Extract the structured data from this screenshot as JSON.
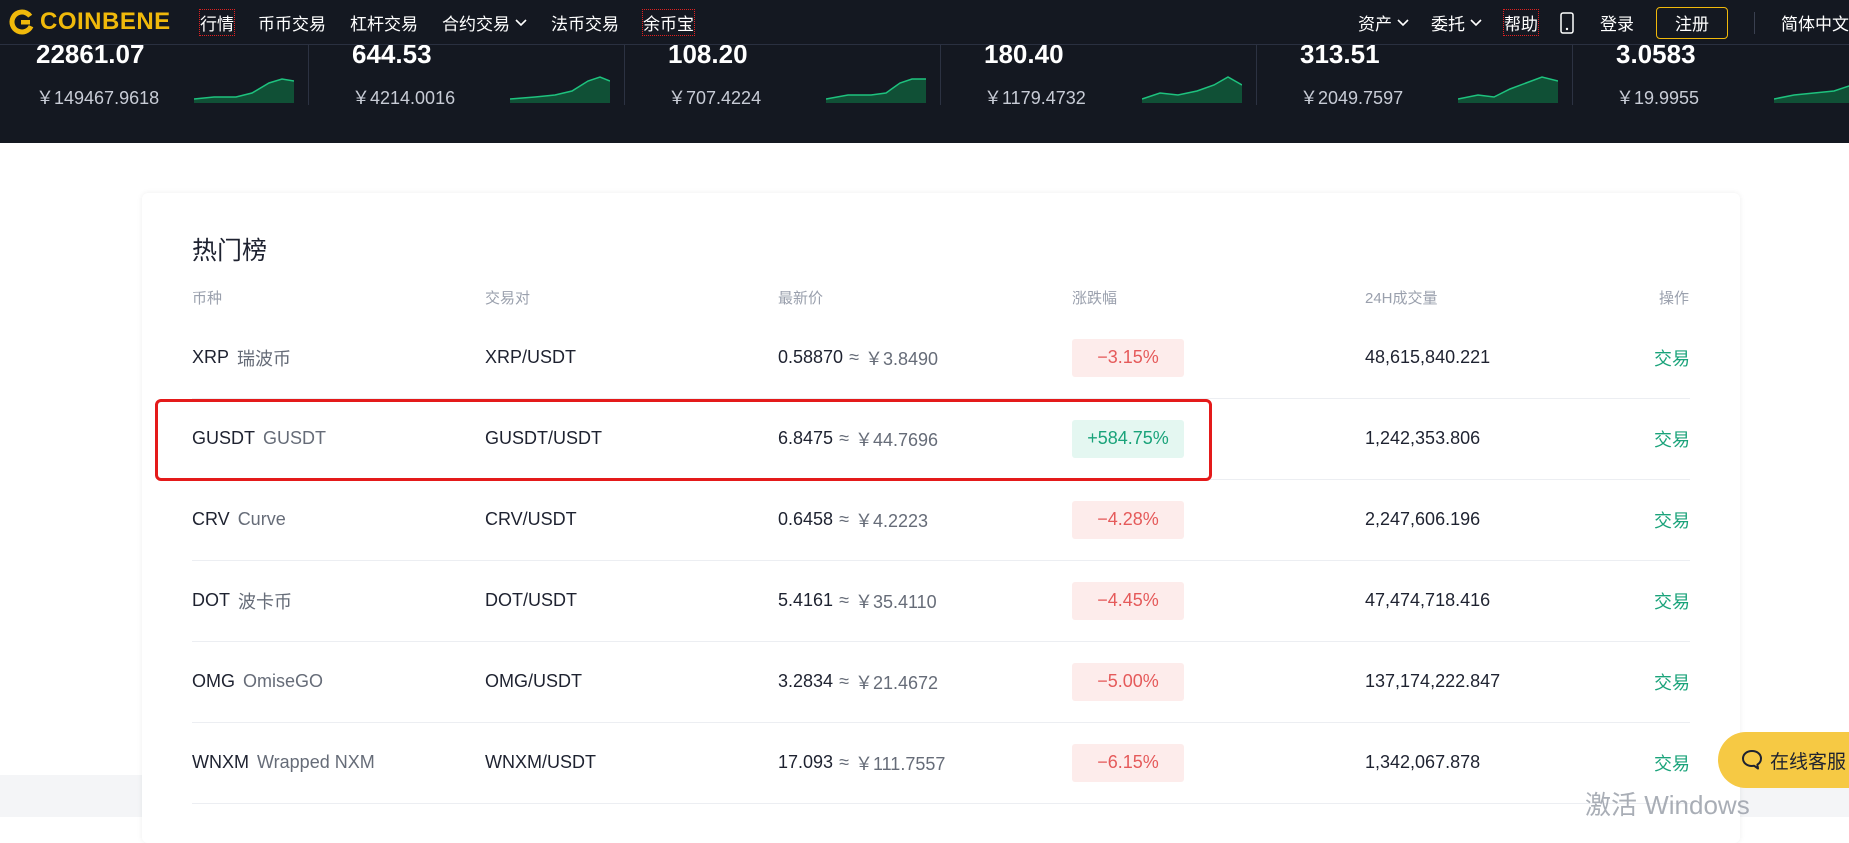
{
  "brand": {
    "name": "COINBENE",
    "color": "#f0b90b"
  },
  "nav": {
    "left": [
      {
        "label": "行情",
        "dropdown": false,
        "dotted": true
      },
      {
        "label": "币币交易",
        "dropdown": false,
        "dotted": false
      },
      {
        "label": "杠杆交易",
        "dropdown": false,
        "dotted": false
      },
      {
        "label": "合约交易",
        "dropdown": true,
        "dotted": false
      },
      {
        "label": "法币交易",
        "dropdown": false,
        "dotted": false
      },
      {
        "label": "余币宝",
        "dropdown": false,
        "dotted": true
      }
    ],
    "right": {
      "assets": "资产",
      "orders": "委托",
      "help": "帮助",
      "phone_icon": "mobile-phone-icon",
      "login": "登录",
      "register": "注册",
      "language": "简体中文"
    }
  },
  "tickers": [
    {
      "price": "22861.07",
      "cny": "￥149467.9618"
    },
    {
      "price": "644.53",
      "cny": "￥4214.0016"
    },
    {
      "price": "108.20",
      "cny": "￥707.4224"
    },
    {
      "price": "180.40",
      "cny": "￥1179.4732"
    },
    {
      "price": "313.51",
      "cny": "￥2049.7597"
    },
    {
      "price": "3.0583",
      "cny": "￥19.9955"
    }
  ],
  "hot": {
    "title": "热门榜",
    "columns": [
      "币种",
      "交易对",
      "最新价",
      "涨跌幅",
      "24H成交量",
      "操作"
    ],
    "rows": [
      {
        "symbol": "XRP",
        "name": "瑞波币",
        "pair": "XRP/USDT",
        "price": "0.58870",
        "approx": "≈",
        "cny": "￥3.8490",
        "change": "−3.15%",
        "direction": "down",
        "volume": "48,615,840.221",
        "action": "交易"
      },
      {
        "symbol": "GUSDT",
        "name": "GUSDT",
        "pair": "GUSDT/USDT",
        "price": "6.8475",
        "approx": "≈",
        "cny": "￥44.7696",
        "change": "+584.75%",
        "direction": "up",
        "volume": "1,242,353.806",
        "action": "交易"
      },
      {
        "symbol": "CRV",
        "name": "Curve",
        "pair": "CRV/USDT",
        "price": "0.6458",
        "approx": "≈",
        "cny": "￥4.2223",
        "change": "−4.28%",
        "direction": "down",
        "volume": "2,247,606.196",
        "action": "交易"
      },
      {
        "symbol": "DOT",
        "name": "波卡币",
        "pair": "DOT/USDT",
        "price": "5.4161",
        "approx": "≈",
        "cny": "￥35.4110",
        "change": "−4.45%",
        "direction": "down",
        "volume": "47,474,718.416",
        "action": "交易"
      },
      {
        "symbol": "OMG",
        "name": "OmiseGO",
        "pair": "OMG/USDT",
        "price": "3.2834",
        "approx": "≈",
        "cny": "￥21.4672",
        "change": "−5.00%",
        "direction": "down",
        "volume": "137,174,222.847",
        "action": "交易"
      },
      {
        "symbol": "WNXM",
        "name": "Wrapped NXM",
        "pair": "WNXM/USDT",
        "price": "17.093",
        "approx": "≈",
        "cny": "￥111.7557",
        "change": "−6.15%",
        "direction": "down",
        "volume": "1,342,067.878",
        "action": "交易"
      }
    ]
  },
  "support": {
    "label": "在线客服",
    "icon": "chat-bubble-icon"
  },
  "watermark": "激活 Windows",
  "colors": {
    "up": "#1aa37a",
    "down": "#e55a5a",
    "nav_bg": "#141821",
    "highlight": "#e41a1a",
    "support": "#f6c944"
  }
}
